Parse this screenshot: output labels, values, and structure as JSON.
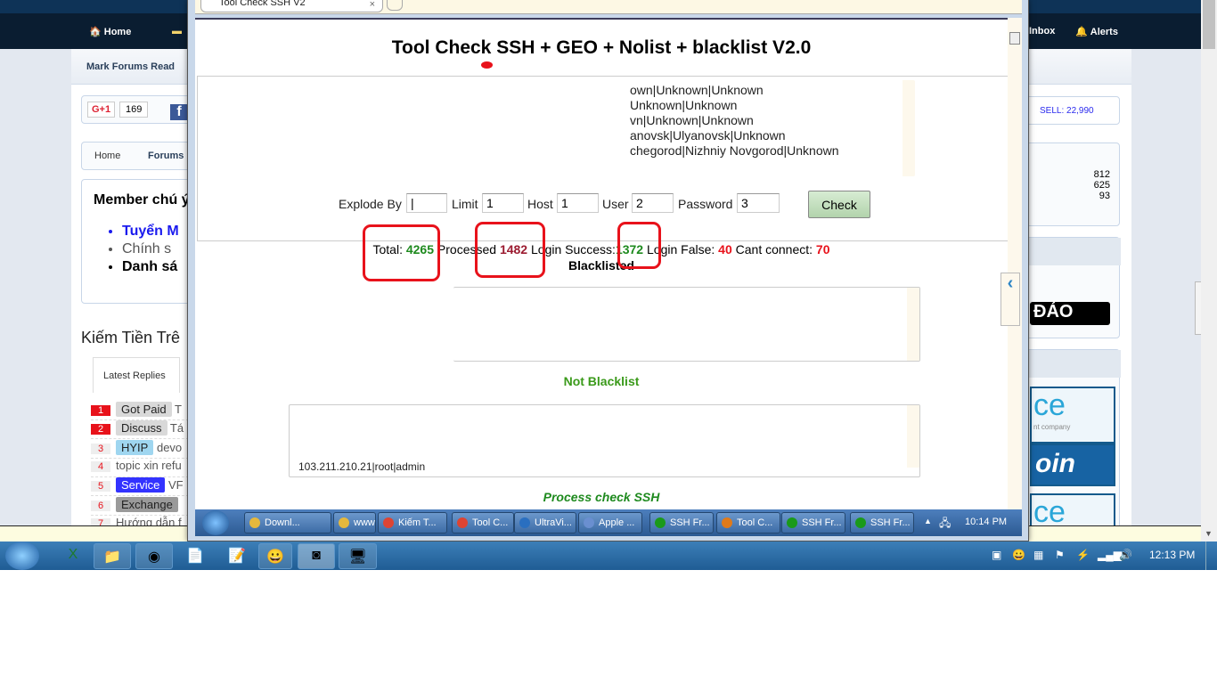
{
  "forum": {
    "nav": {
      "home": "Home",
      "inbox": "Inbox",
      "alerts": "Alerts"
    },
    "mark_forums_read": "Mark Forums Read",
    "gplus": {
      "label": "G+1",
      "count": "169"
    },
    "breadcrumb": [
      "Home",
      "Forums"
    ],
    "notice": {
      "title": "Member chú ý",
      "items": [
        "Tuyển M",
        "Chính s",
        "Danh sá"
      ]
    },
    "section_title": "Kiếm Tiền Trê",
    "tab_latest": "Latest Replies",
    "latest": [
      {
        "n": "1",
        "tag": "Got Paid",
        "text": "T",
        "tagcolor": "#d9d9d9",
        "textcolor": "#222"
      },
      {
        "n": "2",
        "tag": "Discuss",
        "text": "Tá",
        "tagcolor": "#d9d9d9",
        "textcolor": "#222"
      },
      {
        "n": "3",
        "tag": "HYIP",
        "text": "devo",
        "tagcolor": "#9fd6f0",
        "textcolor": "#222"
      },
      {
        "n": "4",
        "tag": "",
        "text": "topic xin refu",
        "tagcolor": "",
        "textcolor": "#222"
      },
      {
        "n": "5",
        "tag": "Service",
        "text": "VF",
        "tagcolor": "#3333ff",
        "textcolor": "#fff"
      },
      {
        "n": "6",
        "tag": "Exchange",
        "text": "",
        "tagcolor": "#9a9a9a",
        "textcolor": "#222"
      },
      {
        "n": "7",
        "tag": "",
        "text": "Hướng dẫn f",
        "tagcolor": "",
        "textcolor": "#222"
      }
    ],
    "sell": "SELL: 22,990",
    "stats": [
      "812",
      "625",
      "93"
    ],
    "banner_text": "ĐẢO",
    "ad1": "ce",
    "ad1_sub": "nt company",
    "ad2": "oin",
    "ad3": "ce"
  },
  "remote": {
    "tab_title": "Tool Check SSH V2",
    "title": "Tool Check SSH + GEO + Nolist + blacklist V2.0",
    "input_lines": [
      "own|Unknown|Unknown",
      "Unknown|Unknown",
      "vn|Unknown|Unknown",
      "anovsk|Ulyanovsk|Unknown",
      "chegorod|Nizhniy Novgorod|Unknown"
    ],
    "form": {
      "explode_label": "Explode By",
      "explode_value": "|",
      "limit_label": "Limit",
      "limit_value": "1",
      "host_label": "Host",
      "host_value": "1",
      "user_label": "User",
      "user_value": "2",
      "password_label": "Password",
      "password_value": "3",
      "check": "Check"
    },
    "stats": {
      "total_label": "Total:",
      "total": "4265",
      "processed_label": "Processed",
      "processed": "1482",
      "success_label": "Login Success:",
      "success": "1372",
      "false_label": "Login False:",
      "false": "40",
      "cant_label": "Cant connect:",
      "cant": "70"
    },
    "blacklisted": "Blacklisted",
    "not_blacklist": "Not Blacklist",
    "not_blacklist_line": "103.211.210.21|root|admin",
    "process": "Process check SSH",
    "taskbar": [
      "Downl...",
      "www",
      "Kiếm T...",
      "Tool C...",
      "UltraVi...",
      "Apple ...",
      "SSH Fr...",
      "Tool C...",
      "SSH Fr...",
      "SSH Fr..."
    ],
    "clock": "10:14 PM"
  },
  "taskbar": {
    "clock": "12:13 PM"
  },
  "colors": {
    "green": "#1e8a1e",
    "maroon": "#9b1b30",
    "red": "#e8121b",
    "nav": "#0a1d31"
  }
}
